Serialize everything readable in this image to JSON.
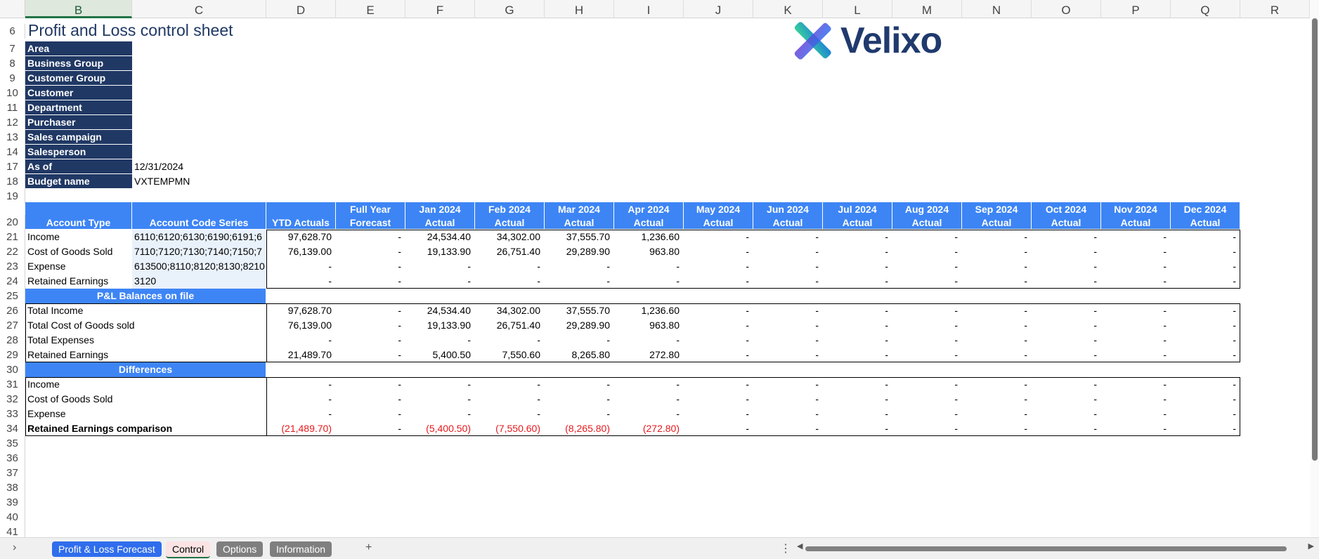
{
  "columns": [
    "B",
    "C",
    "D",
    "E",
    "F",
    "G",
    "H",
    "I",
    "J",
    "K",
    "L",
    "M",
    "N",
    "O",
    "P",
    "Q",
    "R"
  ],
  "selected_column": "B",
  "rows": [
    "6",
    "7",
    "8",
    "9",
    "10",
    "11",
    "12",
    "13",
    "14",
    "17",
    "18",
    "19",
    "20",
    "21",
    "22",
    "23",
    "24",
    "25",
    "26",
    "27",
    "28",
    "29",
    "30",
    "31",
    "32",
    "33",
    "34",
    "35",
    "36",
    "37",
    "38",
    "39",
    "40",
    "41"
  ],
  "title": "Profit and Loss control sheet",
  "logo_text": "Velixo",
  "filters": [
    {
      "label": "Area",
      "value": ""
    },
    {
      "label": "Business Group",
      "value": ""
    },
    {
      "label": "Customer Group",
      "value": ""
    },
    {
      "label": "Customer",
      "value": ""
    },
    {
      "label": "Department",
      "value": ""
    },
    {
      "label": "Purchaser",
      "value": ""
    },
    {
      "label": "Sales campaign",
      "value": ""
    },
    {
      "label": "Salesperson",
      "value": ""
    },
    {
      "label": "As of",
      "value": "12/31/2024"
    },
    {
      "label": "Budget name",
      "value": "VXTEMPMN"
    }
  ],
  "header": {
    "account_type": "Account Type",
    "account_code": "Account Code Series",
    "months": [
      {
        "l1": "",
        "l2": "YTD Actuals"
      },
      {
        "l1": "Full Year",
        "l2": "Forecast"
      },
      {
        "l1": "Jan 2024",
        "l2": "Actual"
      },
      {
        "l1": "Feb 2024",
        "l2": "Actual"
      },
      {
        "l1": "Mar 2024",
        "l2": "Actual"
      },
      {
        "l1": "Apr 2024",
        "l2": "Actual"
      },
      {
        "l1": "May 2024",
        "l2": "Actual"
      },
      {
        "l1": "Jun 2024",
        "l2": "Actual"
      },
      {
        "l1": "Jul 2024",
        "l2": "Actual"
      },
      {
        "l1": "Aug 2024",
        "l2": "Actual"
      },
      {
        "l1": "Sep 2024",
        "l2": "Actual"
      },
      {
        "l1": "Oct 2024",
        "l2": "Actual"
      },
      {
        "l1": "Nov 2024",
        "l2": "Actual"
      },
      {
        "l1": "Dec 2024",
        "l2": "Actual"
      }
    ]
  },
  "accounts": [
    {
      "type": "Income",
      "code": "6110;6120;6130;6190;6191;6",
      "values": [
        "97,628.70",
        "-",
        "24,534.40",
        "34,302.00",
        "37,555.70",
        "1,236.60",
        "-",
        "-",
        "-",
        "-",
        "-",
        "-",
        "-",
        "-"
      ]
    },
    {
      "type": "Cost of Goods Sold",
      "code": "7110;7120;7130;7140;7150;7",
      "values": [
        "76,139.00",
        "-",
        "19,133.90",
        "26,751.40",
        "29,289.90",
        "963.80",
        "-",
        "-",
        "-",
        "-",
        "-",
        "-",
        "-",
        "-"
      ]
    },
    {
      "type": "Expense",
      "code": "613500;8110;8120;8130;8210",
      "values": [
        "-",
        "-",
        "-",
        "-",
        "-",
        "-",
        "-",
        "-",
        "-",
        "-",
        "-",
        "-",
        "-",
        "-"
      ]
    },
    {
      "type": "Retained Earnings",
      "code": "3120",
      "values": [
        "-",
        "-",
        "-",
        "-",
        "-",
        "-",
        "-",
        "-",
        "-",
        "-",
        "-",
        "-",
        "-",
        "-"
      ]
    }
  ],
  "section_balances": "P&L Balances on file",
  "balances": [
    {
      "label": "Total Income",
      "values": [
        "97,628.70",
        "-",
        "24,534.40",
        "34,302.00",
        "37,555.70",
        "1,236.60",
        "-",
        "-",
        "-",
        "-",
        "-",
        "-",
        "-",
        "-"
      ]
    },
    {
      "label": "Total Cost of Goods sold",
      "values": [
        "76,139.00",
        "-",
        "19,133.90",
        "26,751.40",
        "29,289.90",
        "963.80",
        "-",
        "-",
        "-",
        "-",
        "-",
        "-",
        "-",
        "-"
      ]
    },
    {
      "label": "Total Expenses",
      "values": [
        "-",
        "-",
        "-",
        "-",
        "-",
        "-",
        "-",
        "-",
        "-",
        "-",
        "-",
        "-",
        "-",
        "-"
      ]
    },
    {
      "label": "Retained Earnings",
      "values": [
        "21,489.70",
        "-",
        "5,400.50",
        "7,550.60",
        "8,265.80",
        "272.80",
        "-",
        "-",
        "-",
        "-",
        "-",
        "-",
        "-",
        "-"
      ]
    }
  ],
  "section_differences": "Differences",
  "differences": [
    {
      "label": "Income",
      "values": [
        "-",
        "-",
        "-",
        "-",
        "-",
        "-",
        "-",
        "-",
        "-",
        "-",
        "-",
        "-",
        "-",
        "-"
      ]
    },
    {
      "label": "Cost of Goods Sold",
      "values": [
        "-",
        "-",
        "-",
        "-",
        "-",
        "-",
        "-",
        "-",
        "-",
        "-",
        "-",
        "-",
        "-",
        "-"
      ]
    },
    {
      "label": "Expense",
      "values": [
        "-",
        "-",
        "-",
        "-",
        "-",
        "-",
        "-",
        "-",
        "-",
        "-",
        "-",
        "-",
        "-",
        "-"
      ]
    },
    {
      "label": "Retained Earnings comparison",
      "bold": true,
      "values": [
        "(21,489.70)",
        "-",
        "(5,400.50)",
        "(7,550.60)",
        "(8,265.80)",
        "(272.80)",
        "-",
        "-",
        "-",
        "-",
        "-",
        "-",
        "-",
        "-"
      ]
    }
  ],
  "tabs": [
    {
      "label": "Profit & Loss Forecast",
      "style": "blue"
    },
    {
      "label": "Control",
      "style": "active"
    },
    {
      "label": "Options",
      "style": "gray"
    },
    {
      "label": "Information",
      "style": "gray"
    }
  ],
  "add_sheet": "+",
  "nav_prev": "›",
  "more": "⋮",
  "colors": {
    "navy": "#203864",
    "blue": "#3d85f5",
    "negative": "#e8191c",
    "title": "#1f3864"
  }
}
